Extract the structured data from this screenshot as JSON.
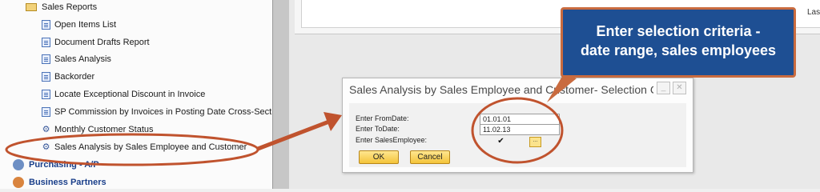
{
  "tree": {
    "folder": "Sales Reports",
    "items": [
      {
        "label": "Open Items List"
      },
      {
        "label": "Document Drafts Report"
      },
      {
        "label": "Sales Analysis"
      },
      {
        "label": "Backorder"
      },
      {
        "label": "Locate Exceptional Discount in Invoice"
      },
      {
        "label": "SP Commission by Invoices in Posting Date Cross-Section"
      },
      {
        "label": "Monthly Customer Status"
      },
      {
        "label": "Sales Analysis by Sales Employee and Customer"
      }
    ],
    "modules": [
      {
        "label": "Purchasing - A/P"
      },
      {
        "label": "Business Partners"
      }
    ]
  },
  "main": {
    "header_partial": "Las"
  },
  "callout": {
    "line1": "Enter selection criteria -",
    "line2": "date range, sales employees"
  },
  "dialog": {
    "title": "Sales Analysis by Sales Employee and Customer- Selection Criteria",
    "from_label": "Enter FromDate:",
    "from_value": "01.01.01",
    "to_label": "Enter ToDate:",
    "to_value": "11.02.13",
    "emp_label": "Enter SalesEmployee:",
    "emp_checked": "✔",
    "lookup_label": "...",
    "ok_label": "OK",
    "cancel_label": "Cancel",
    "minimize_glyph": "_",
    "close_glyph": "✕"
  },
  "colors": {
    "annotation": "#c0532e",
    "callout_bg": "#1e4f93",
    "button": "#f4c43a"
  }
}
